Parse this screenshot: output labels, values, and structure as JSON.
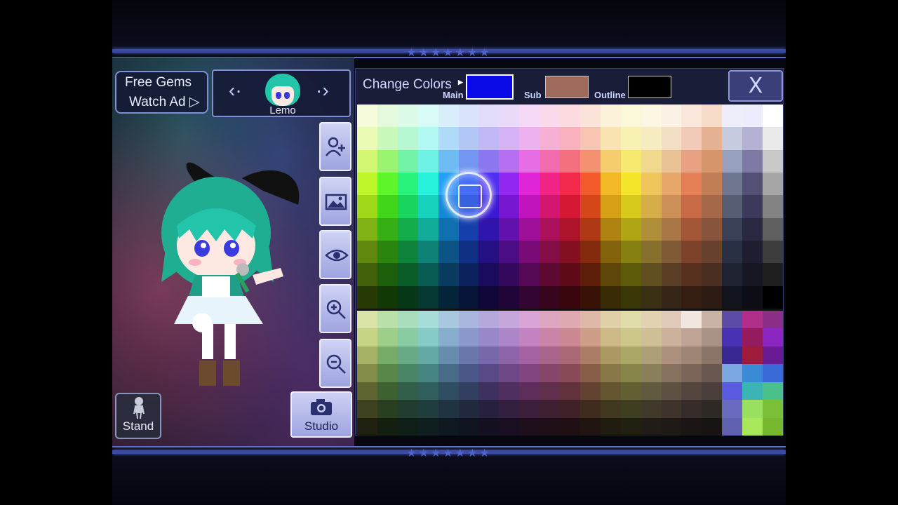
{
  "header": {
    "stars": "★★★★★★★"
  },
  "footer": {
    "stars": "★★★★★★★"
  },
  "gems": {
    "line1": "Free Gems",
    "line2": "Watch Ad ▷"
  },
  "character": {
    "name": "Lemo",
    "prev": "‹·",
    "next": "·›"
  },
  "tools": [
    "add-character-icon",
    "background-icon",
    "eye-icon",
    "zoom-in-icon",
    "zoom-out-icon"
  ],
  "stand": {
    "label": "Stand"
  },
  "studio": {
    "label": "Studio"
  },
  "colors_panel": {
    "title": "Change Colors",
    "main_label": "Main",
    "sub_label": "Sub",
    "outline_label": "Outline",
    "main_color": "#0a0ae6",
    "sub_color": "#9e6a5c",
    "outline_color": "#000000",
    "close_label": "X"
  },
  "palette": {
    "rows": [
      [
        "#f6fbdc",
        "#e5fadc",
        "#dbfbe8",
        "#d9fbf7",
        "#d8eefb",
        "#d9e3fb",
        "#e0dcfa",
        "#eadafa",
        "#f5d9f6",
        "#fad9ea",
        "#fbdbe0",
        "#fbe3d9",
        "#fbf2d9",
        "#fbf8da",
        "#fbf7e2",
        "#fbf1e4",
        "#fbe6dc",
        "#f6dbc8",
        "#eeeefa",
        "#ececfc",
        "#ffffff"
      ],
      [
        "#eafbb4",
        "#c8f9b8",
        "#b5f8d2",
        "#b2f8f3",
        "#b0dbf8",
        "#b3c7f7",
        "#c2b7f7",
        "#d6b3f6",
        "#eeb1ef",
        "#f7b0d3",
        "#f9b2bd",
        "#f9c5b3",
        "#f9e4b1",
        "#f8f2b2",
        "#f5ecc1",
        "#f3dfc4",
        "#f1cab8",
        "#e4b293",
        "#c6cbe0",
        "#b4b2d3",
        "#eaeaea"
      ],
      [
        "#d4f773",
        "#99f56f",
        "#72f3a6",
        "#6ff2e6",
        "#6cbcf3",
        "#7296f1",
        "#8c77f1",
        "#b56ff0",
        "#e66de4",
        "#f26bad",
        "#f4707e",
        "#f49170",
        "#f5cd6c",
        "#f5ea6f",
        "#f0d98d",
        "#ebc196",
        "#e8a283",
        "#d6956a",
        "#98a2bf",
        "#7e7aa6",
        "#c9c9c9"
      ],
      [
        "#bff52b",
        "#5ef52a",
        "#2af37b",
        "#28f2dc",
        "#25a0f2",
        "#2a63f0",
        "#5030f0",
        "#9228ef",
        "#e025d9",
        "#f02484",
        "#f2294a",
        "#f25a29",
        "#f2b826",
        "#f4e52a",
        "#eec65c",
        "#e8a76a",
        "#e47f56",
        "#c07c55",
        "#6e778f",
        "#525075",
        "#a6a6a6"
      ],
      [
        "#a0d91a",
        "#41d619",
        "#19d55d",
        "#17d3be",
        "#1488d6",
        "#1a4fd3",
        "#3b1ad3",
        "#7817d2",
        "#c114bc",
        "#d31670",
        "#d51935",
        "#d54619",
        "#d6a016",
        "#d6c91a",
        "#d5ae49",
        "#cc8f57",
        "#c86a45",
        "#a56849",
        "#565e73",
        "#3c3a5a",
        "#838383"
      ],
      [
        "#81b215",
        "#36af14",
        "#14ad4c",
        "#12ac9a",
        "#106faf",
        "#1540ac",
        "#3015ac",
        "#6212ac",
        "#9e0f9a",
        "#ac125b",
        "#ae142c",
        "#ae3914",
        "#ae8312",
        "#afa515",
        "#b08f3b",
        "#a87647",
        "#a45737",
        "#87553c",
        "#3b4257",
        "#2a2942",
        "#5f5f5f"
      ],
      [
        "#61870f",
        "#29850e",
        "#0e833a",
        "#0d8275",
        "#0b5485",
        "#0f3083",
        "#240f83",
        "#4a0d83",
        "#780b75",
        "#830d45",
        "#840f21",
        "#842b0e",
        "#84630d",
        "#85800f",
        "#86702e",
        "#805a36",
        "#7c422a",
        "#67412e",
        "#2a3044",
        "#1f1e31",
        "#3d3d3d"
      ],
      [
        "#43600a",
        "#1c5e0a",
        "#0a5d28",
        "#095c53",
        "#083b5e",
        "#0b225d",
        "#1a0b5d",
        "#34095d",
        "#550853",
        "#5d0931",
        "#5e0b17",
        "#5e1f0a",
        "#5e4609",
        "#5e5b0b",
        "#604f20",
        "#5a3f26",
        "#58301e",
        "#492e21",
        "#1e2231",
        "#171623",
        "#1f1f1f"
      ],
      [
        "#273a06",
        "#113906",
        "#063818",
        "#053832",
        "#042439",
        "#061438",
        "#100638",
        "#200538",
        "#330532",
        "#38051e",
        "#39060e",
        "#391206",
        "#392b05",
        "#393706",
        "#3a3013",
        "#362617",
        "#351d12",
        "#2c1c14",
        "#12141d",
        "#0e0d15",
        "#000000"
      ],
      [
        "#d9e4a6",
        "#b9e0a9",
        "#a9debd",
        "#a6ddd9",
        "#a7c8de",
        "#aab6dd",
        "#b5a9dc",
        "#c6a7dc",
        "#d8a5d6",
        "#dca6c1",
        "#dea9b0",
        "#dfb9a8",
        "#dfd0a7",
        "#dfdcaa",
        "#e1d3b2",
        "#e0caba",
        "#f0e8e0",
        "#c8b3a6",
        "#5c4aa4",
        "#b02e8a",
        "#8a2e88"
      ],
      [
        "#c6d486",
        "#9dcf89",
        "#89cca3",
        "#86cbc6",
        "#86aecc",
        "#8a98cb",
        "#9888ca",
        "#ad86ca",
        "#c383c1",
        "#ca84a7",
        "#cb8893",
        "#cd9d88",
        "#cdb986",
        "#cdc889",
        "#cfbf97",
        "#ccb19d",
        "#bfa495",
        "#a99387",
        "#4a30b2",
        "#961a5e",
        "#8c26c0"
      ],
      [
        "#a5b165",
        "#76ac68",
        "#68aa85",
        "#65a9a4",
        "#668dab",
        "#6977aa",
        "#7867a9",
        "#8e64a9",
        "#a562a2",
        "#a96489",
        "#aa6774",
        "#ab7c66",
        "#ab9964",
        "#aba867",
        "#ad9f77",
        "#ab917d",
        "#9f8576",
        "#8b7568",
        "#392892",
        "#9c1c3a",
        "#6a1a92"
      ],
      [
        "#838c48",
        "#588749",
        "#498666",
        "#478582",
        "#486c87",
        "#4b5786",
        "#594985",
        "#6e4786",
        "#83457f",
        "#86466a",
        "#874a56",
        "#885e48",
        "#887847",
        "#88854a",
        "#89805b",
        "#877261",
        "#7b655a",
        "#685850",
        "#7aa6e2",
        "#3a8ad8",
        "#3a6ad8"
      ],
      [
        "#5e6530",
        "#3d6131",
        "#315f4a",
        "#2f5e5d",
        "#304e61",
        "#323f60",
        "#3e315f",
        "#4e2f60",
        "#5d2e5a",
        "#602f4b",
        "#61323c",
        "#624230",
        "#62552f",
        "#625f32",
        "#615a40",
        "#5f5044",
        "#55453f",
        "#4a3f3a",
        "#5a5ae0",
        "#3ab4b4",
        "#4ac08a"
      ],
      [
        "#3e421f",
        "#283f20",
        "#203d30",
        "#1f3d3d",
        "#1f3340",
        "#21293f",
        "#28203f",
        "#331f40",
        "#3d1e3b",
        "#3f1f32",
        "#402127",
        "#402b1f",
        "#40381f",
        "#403e21",
        "#3f3a2a",
        "#3e342c",
        "#362c29",
        "#2f2926",
        "#6a6abe",
        "#9ae060",
        "#7ac036"
      ],
      [
        "#1e2010",
        "#141f10",
        "#101e18",
        "#0f1e1e",
        "#0f1920",
        "#10141f",
        "#14101f",
        "#190f20",
        "#1e0f1d",
        "#1f0f19",
        "#201013",
        "#201510",
        "#201c10",
        "#201f10",
        "#1f1d15",
        "#1f1a16",
        "#1b1614",
        "#181413",
        "#6060b0",
        "#a8e85a",
        "#78b830"
      ]
    ]
  }
}
